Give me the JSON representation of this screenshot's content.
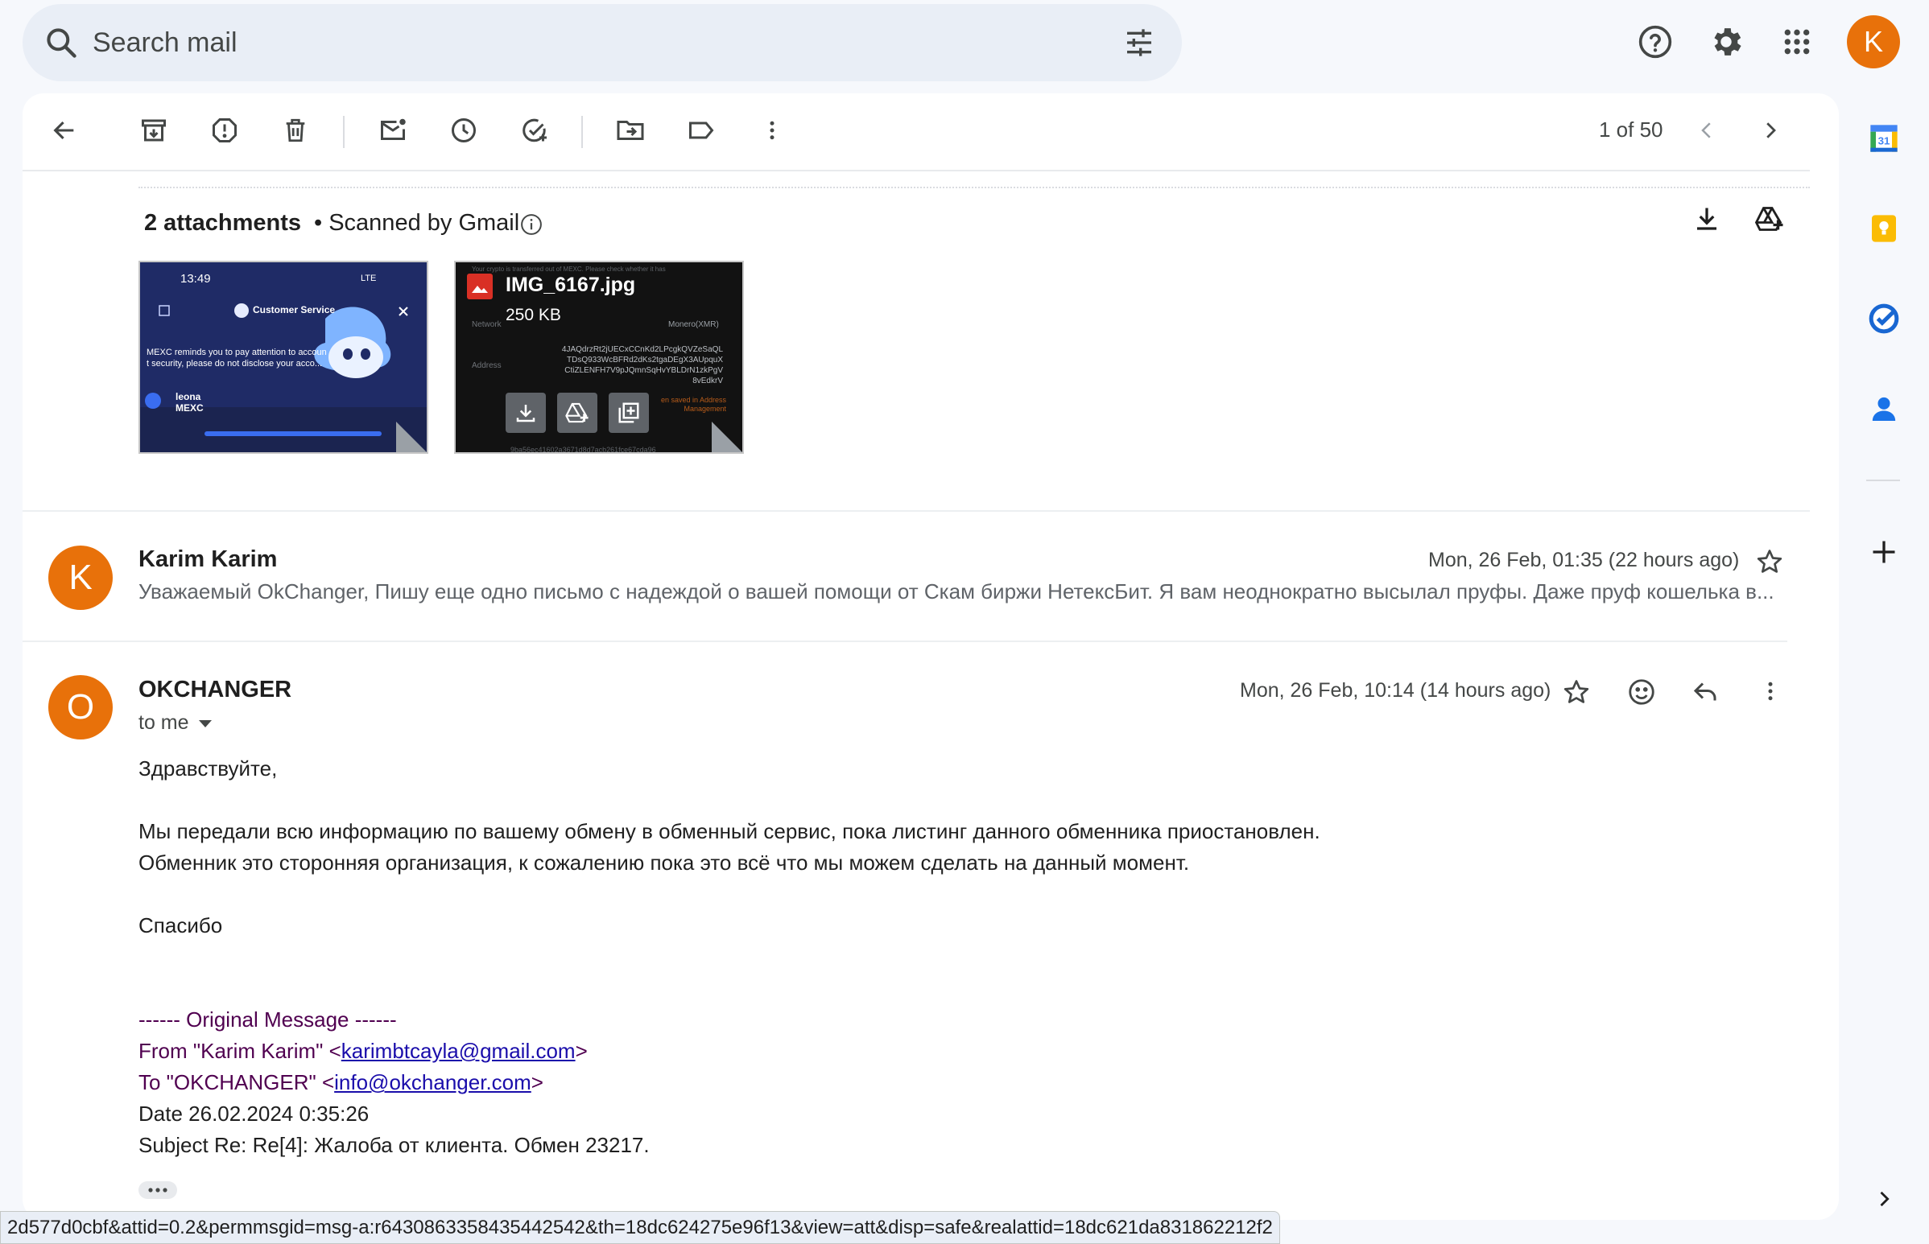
{
  "search": {
    "placeholder": "Search mail"
  },
  "account": {
    "initial": "K"
  },
  "toolbar": {
    "pager": "1 of 50"
  },
  "attachments": {
    "title": "2 attachments",
    "scanned": "• Scanned by Gmail",
    "items": [
      {
        "time": "13:49",
        "signal": "LTE",
        "service": "Customer Service",
        "notice1": "MEXC reminds you to pay attention to accoun",
        "notice2": "t security, please do not disclose your acco...",
        "agent": "leona",
        "agent_org": "MEXC"
      },
      {
        "name": "IMG_6167.jpg",
        "size": "250 KB",
        "bg_text1": "Your crypto is transferred out of MEXC. Please check whether it has",
        "bg_network": "Network",
        "bg_network_val": "Monero(XMR)",
        "bg_address": "Address",
        "bg_addr1": "4JAQdrzRt2jUECxCCnKd2LPcgkQVZeSaQL",
        "bg_addr2": "TDsQ933WcBFRd2dKs2tgaDEgX3AUpquX",
        "bg_addr3": "CtiZLENFH7V9pJQmnSqHvYBLDrN1zkPgV",
        "bg_addr4": "8vEdkrV",
        "bg_saved": "en saved in Address",
        "bg_saved2": "Management",
        "bg_hash": "9ba56ec41602a3671d8d7acb261fce67cda96"
      }
    ]
  },
  "messages": [
    {
      "sender": "Karim Karim",
      "initial": "K",
      "date": "Mon, 26 Feb, 01:35 (22 hours ago)",
      "snippet": "Уважаемый OkChanger, Пишу еще одно письмо с надеждой о вашей помощи от Скам биржи НетексБит. Я вам неоднократно высылал пруфы. Даже пруф кошелька в..."
    },
    {
      "sender": "OKCHANGER",
      "initial": "O",
      "date": "Mon, 26 Feb, 10:14 (14 hours ago)",
      "to": "to me",
      "greeting": "Здравствуйте,",
      "para1": "Мы передали всю информацию по вашему обмену в обменный сервис, пока листинг данного обменника приостановлен.",
      "para2": "Обменник это сторонняя организация, к сожалению пока это всё что мы можем сделать на данный момент.",
      "thanks": "Спасибо",
      "original": {
        "header": "------ Original Message ------",
        "from_prefix": "From \"Karim Karim\" <",
        "from_email": "karimbtcayla@gmail.com",
        "to_prefix": "To \"OKCHANGER\" <",
        "to_email": "info@okchanger.com",
        "suffix": ">",
        "date": "Date 26.02.2024 0:35:26",
        "subject": "Subject Re: Re[4]: Жалоба от клиента. Обмен 23217."
      }
    }
  ],
  "status_url": "2d577d0cbf&attid=0.2&permmsgid=msg-a:r6430863358435442542&th=18dc624275e96f13&view=att&disp=safe&realattid=18dc621da831862212f2",
  "side_panel": {
    "calendar_day": "31"
  }
}
